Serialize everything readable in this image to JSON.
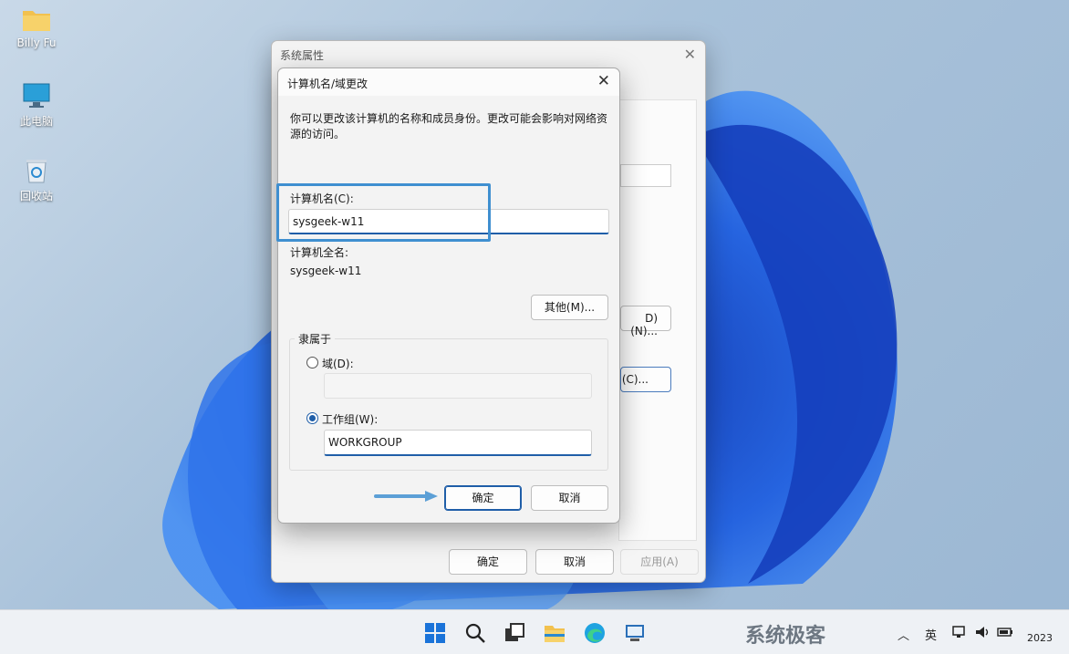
{
  "desktop": {
    "icons": [
      {
        "label": "Billy Fu",
        "icon": "folder-icon"
      },
      {
        "label": "此电脑",
        "icon": "computer-icon"
      },
      {
        "label": "回收站",
        "icon": "recycle-bin-icon"
      }
    ]
  },
  "back_window": {
    "title": "系统属性",
    "partial_btn1": "D)(N)...",
    "partial_btn2": "(C)...",
    "ok_label": "确定",
    "cancel_label": "取消",
    "apply_label": "应用(A)"
  },
  "dialog": {
    "title": "计算机名/域更改",
    "description": "你可以更改该计算机的名称和成员身份。更改可能会影响对网络资源的访问。",
    "computer_name_label": "计算机名(C):",
    "computer_name_value": "sysgeek-w11",
    "full_name_label": "计算机全名:",
    "full_name_value": "sysgeek-w11",
    "other_button": "其他(M)...",
    "member_of_label": "隶属于",
    "domain_label": "域(D):",
    "domain_value": "",
    "workgroup_label": "工作组(W):",
    "workgroup_value": "WORKGROUP",
    "ok_label": "确定",
    "cancel_label": "取消"
  },
  "taskbar": {
    "watermark": "系统极客",
    "tray_lang": "英",
    "clock_year": "2023"
  },
  "colors": {
    "accent": "#1f5ea8",
    "highlight": "#3f8fd0"
  }
}
